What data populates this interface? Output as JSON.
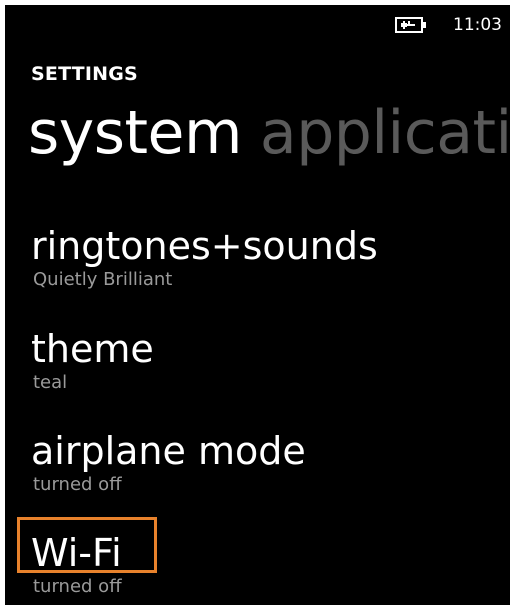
{
  "status_bar": {
    "time": "11:03",
    "battery_icon": "battery-charging-icon"
  },
  "header": {
    "label": "SETTINGS"
  },
  "pivot": {
    "tabs": [
      {
        "label": "system"
      },
      {
        "label": "applications"
      }
    ]
  },
  "settings": {
    "items": [
      {
        "title": "ringtones+sounds",
        "subtitle": "Quietly Brilliant"
      },
      {
        "title": "theme",
        "subtitle": "teal"
      },
      {
        "title": "airplane mode",
        "subtitle": "turned off"
      },
      {
        "title": "Wi-Fi",
        "subtitle": "turned off"
      }
    ]
  },
  "colors": {
    "highlight": "#e8822c",
    "background": "#000000",
    "subtitle": "#9a9a9a"
  }
}
